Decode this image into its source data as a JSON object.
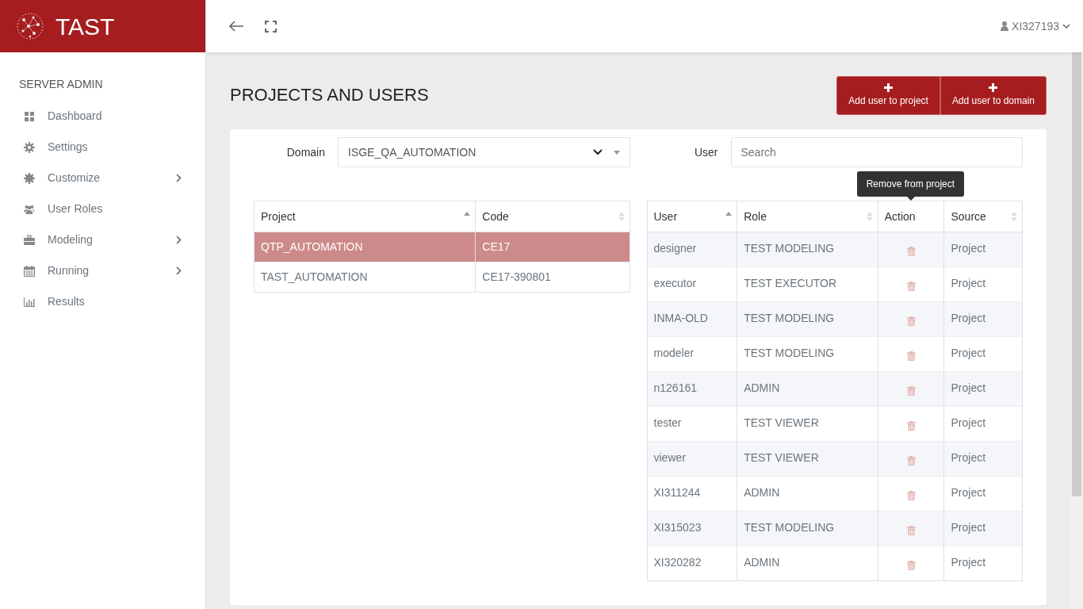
{
  "brand": {
    "title": "TAST"
  },
  "topbar": {
    "user": "XI327193"
  },
  "sidebar": {
    "section": "SERVER ADMIN",
    "items": [
      {
        "label": "Dashboard",
        "expandable": false
      },
      {
        "label": "Settings",
        "expandable": false
      },
      {
        "label": "Customize",
        "expandable": true
      },
      {
        "label": "User Roles",
        "expandable": false
      },
      {
        "label": "Modeling",
        "expandable": true
      },
      {
        "label": "Running",
        "expandable": true
      },
      {
        "label": "Results",
        "expandable": false
      }
    ]
  },
  "page": {
    "title": "PROJECTS AND USERS",
    "actions": [
      "Add user to project",
      "Add user to domain"
    ]
  },
  "filters": {
    "domain_label": "Domain",
    "domain_value": "ISGE_QA_AUTOMATION",
    "user_label": "User",
    "user_placeholder": "Search"
  },
  "projects": {
    "columns": [
      {
        "label": "Project",
        "sorted": true
      },
      {
        "label": "Code",
        "sorted": false
      }
    ],
    "rows": [
      {
        "project": "QTP_AUTOMATION",
        "code": "CE17",
        "selected": true
      },
      {
        "project": "TAST_AUTOMATION",
        "code": "CE17-390801",
        "selected": false
      }
    ]
  },
  "users": {
    "columns": [
      {
        "label": "User",
        "sorted": true
      },
      {
        "label": "Role",
        "sorted": false
      },
      {
        "label": "Action"
      },
      {
        "label": "Source",
        "sorted": false
      }
    ],
    "tooltip": "Remove from project",
    "rows": [
      {
        "user": "designer",
        "role": "TEST MODELING",
        "source": "Project"
      },
      {
        "user": "executor",
        "role": "TEST EXECUTOR",
        "source": "Project"
      },
      {
        "user": "INMA-OLD",
        "role": "TEST MODELING",
        "source": "Project"
      },
      {
        "user": "modeler",
        "role": "TEST MODELING",
        "source": "Project"
      },
      {
        "user": "n126161",
        "role": "ADMIN",
        "source": "Project"
      },
      {
        "user": "tester",
        "role": "TEST VIEWER",
        "source": "Project"
      },
      {
        "user": "viewer",
        "role": "TEST VIEWER",
        "source": "Project"
      },
      {
        "user": "XI311244",
        "role": "ADMIN",
        "source": "Project"
      },
      {
        "user": "XI315023",
        "role": "TEST MODELING",
        "source": "Project"
      },
      {
        "user": "XI320282",
        "role": "ADMIN",
        "source": "Project"
      }
    ]
  }
}
